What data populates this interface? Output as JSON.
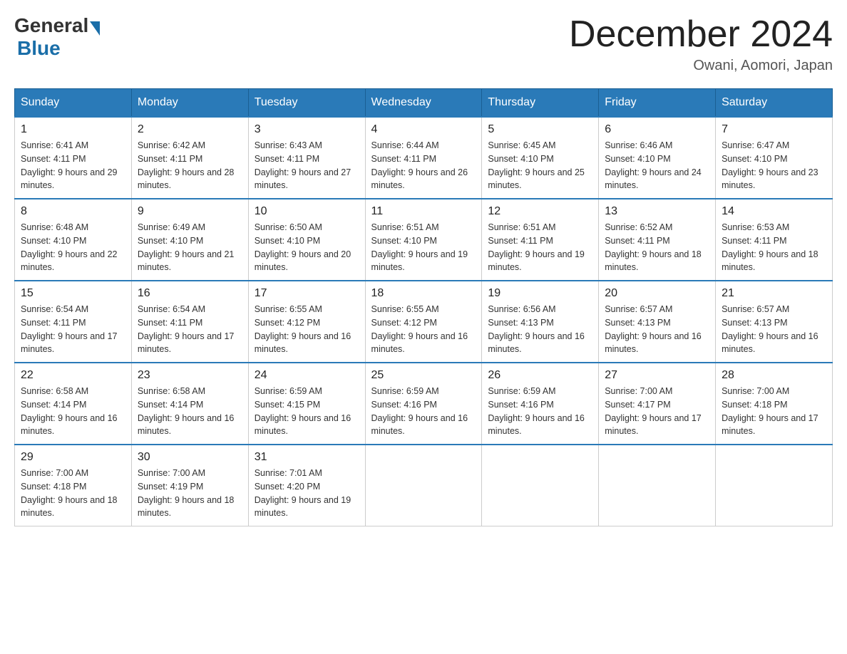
{
  "header": {
    "logo_general": "General",
    "logo_blue": "Blue",
    "month_title": "December 2024",
    "location": "Owani, Aomori, Japan"
  },
  "days_of_week": [
    "Sunday",
    "Monday",
    "Tuesday",
    "Wednesday",
    "Thursday",
    "Friday",
    "Saturday"
  ],
  "weeks": [
    [
      {
        "day": "1",
        "sunrise": "6:41 AM",
        "sunset": "4:11 PM",
        "daylight": "9 hours and 29 minutes."
      },
      {
        "day": "2",
        "sunrise": "6:42 AM",
        "sunset": "4:11 PM",
        "daylight": "9 hours and 28 minutes."
      },
      {
        "day": "3",
        "sunrise": "6:43 AM",
        "sunset": "4:11 PM",
        "daylight": "9 hours and 27 minutes."
      },
      {
        "day": "4",
        "sunrise": "6:44 AM",
        "sunset": "4:11 PM",
        "daylight": "9 hours and 26 minutes."
      },
      {
        "day": "5",
        "sunrise": "6:45 AM",
        "sunset": "4:10 PM",
        "daylight": "9 hours and 25 minutes."
      },
      {
        "day": "6",
        "sunrise": "6:46 AM",
        "sunset": "4:10 PM",
        "daylight": "9 hours and 24 minutes."
      },
      {
        "day": "7",
        "sunrise": "6:47 AM",
        "sunset": "4:10 PM",
        "daylight": "9 hours and 23 minutes."
      }
    ],
    [
      {
        "day": "8",
        "sunrise": "6:48 AM",
        "sunset": "4:10 PM",
        "daylight": "9 hours and 22 minutes."
      },
      {
        "day": "9",
        "sunrise": "6:49 AM",
        "sunset": "4:10 PM",
        "daylight": "9 hours and 21 minutes."
      },
      {
        "day": "10",
        "sunrise": "6:50 AM",
        "sunset": "4:10 PM",
        "daylight": "9 hours and 20 minutes."
      },
      {
        "day": "11",
        "sunrise": "6:51 AM",
        "sunset": "4:10 PM",
        "daylight": "9 hours and 19 minutes."
      },
      {
        "day": "12",
        "sunrise": "6:51 AM",
        "sunset": "4:11 PM",
        "daylight": "9 hours and 19 minutes."
      },
      {
        "day": "13",
        "sunrise": "6:52 AM",
        "sunset": "4:11 PM",
        "daylight": "9 hours and 18 minutes."
      },
      {
        "day": "14",
        "sunrise": "6:53 AM",
        "sunset": "4:11 PM",
        "daylight": "9 hours and 18 minutes."
      }
    ],
    [
      {
        "day": "15",
        "sunrise": "6:54 AM",
        "sunset": "4:11 PM",
        "daylight": "9 hours and 17 minutes."
      },
      {
        "day": "16",
        "sunrise": "6:54 AM",
        "sunset": "4:11 PM",
        "daylight": "9 hours and 17 minutes."
      },
      {
        "day": "17",
        "sunrise": "6:55 AM",
        "sunset": "4:12 PM",
        "daylight": "9 hours and 16 minutes."
      },
      {
        "day": "18",
        "sunrise": "6:55 AM",
        "sunset": "4:12 PM",
        "daylight": "9 hours and 16 minutes."
      },
      {
        "day": "19",
        "sunrise": "6:56 AM",
        "sunset": "4:13 PM",
        "daylight": "9 hours and 16 minutes."
      },
      {
        "day": "20",
        "sunrise": "6:57 AM",
        "sunset": "4:13 PM",
        "daylight": "9 hours and 16 minutes."
      },
      {
        "day": "21",
        "sunrise": "6:57 AM",
        "sunset": "4:13 PM",
        "daylight": "9 hours and 16 minutes."
      }
    ],
    [
      {
        "day": "22",
        "sunrise": "6:58 AM",
        "sunset": "4:14 PM",
        "daylight": "9 hours and 16 minutes."
      },
      {
        "day": "23",
        "sunrise": "6:58 AM",
        "sunset": "4:14 PM",
        "daylight": "9 hours and 16 minutes."
      },
      {
        "day": "24",
        "sunrise": "6:59 AM",
        "sunset": "4:15 PM",
        "daylight": "9 hours and 16 minutes."
      },
      {
        "day": "25",
        "sunrise": "6:59 AM",
        "sunset": "4:16 PM",
        "daylight": "9 hours and 16 minutes."
      },
      {
        "day": "26",
        "sunrise": "6:59 AM",
        "sunset": "4:16 PM",
        "daylight": "9 hours and 16 minutes."
      },
      {
        "day": "27",
        "sunrise": "7:00 AM",
        "sunset": "4:17 PM",
        "daylight": "9 hours and 17 minutes."
      },
      {
        "day": "28",
        "sunrise": "7:00 AM",
        "sunset": "4:18 PM",
        "daylight": "9 hours and 17 minutes."
      }
    ],
    [
      {
        "day": "29",
        "sunrise": "7:00 AM",
        "sunset": "4:18 PM",
        "daylight": "9 hours and 18 minutes."
      },
      {
        "day": "30",
        "sunrise": "7:00 AM",
        "sunset": "4:19 PM",
        "daylight": "9 hours and 18 minutes."
      },
      {
        "day": "31",
        "sunrise": "7:01 AM",
        "sunset": "4:20 PM",
        "daylight": "9 hours and 19 minutes."
      },
      null,
      null,
      null,
      null
    ]
  ]
}
